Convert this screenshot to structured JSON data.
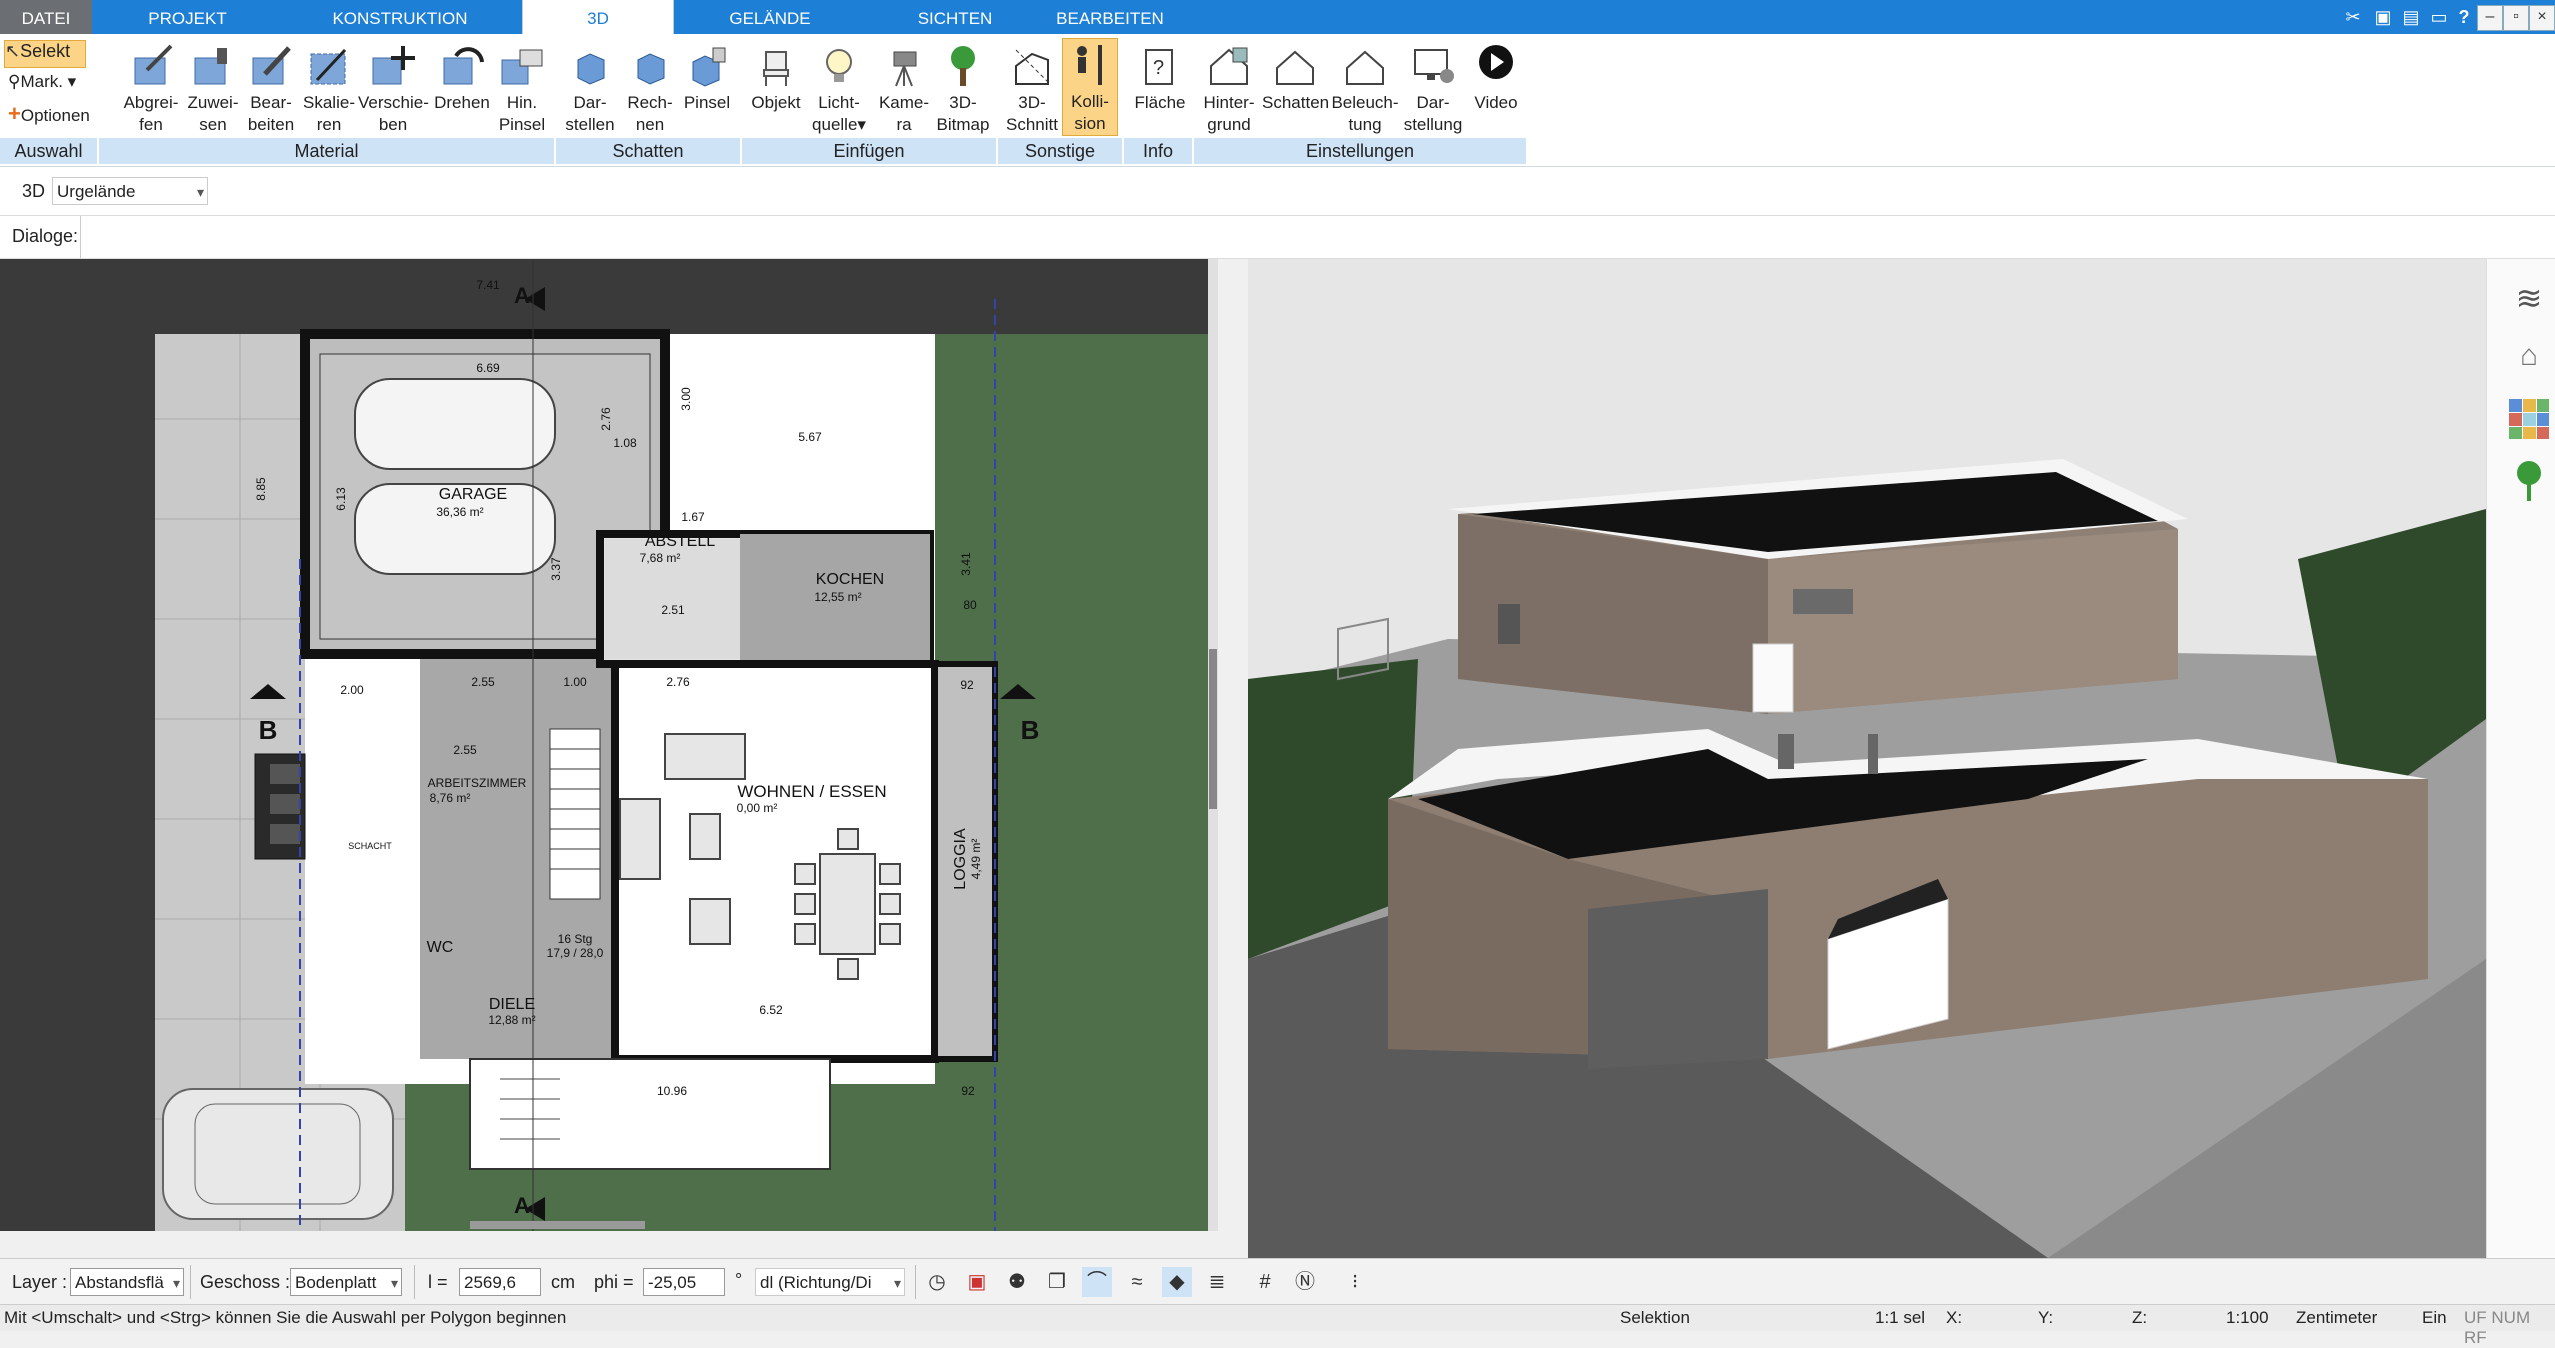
{
  "tabs": [
    {
      "label": "DATEI"
    },
    {
      "label": "PROJEKT"
    },
    {
      "label": "KONSTRUKTION"
    },
    {
      "label": "3D"
    },
    {
      "label": "GELÄNDE"
    },
    {
      "label": "SICHTEN"
    },
    {
      "label": "BEARBEITEN"
    }
  ],
  "auswahl": {
    "selekt": "Selekt",
    "mark": "Mark.",
    "optionen": "Optionen",
    "group": "Auswahl"
  },
  "ribbon_groups": {
    "material": {
      "label": "Material",
      "buttons": [
        {
          "l1": "Abgrei-",
          "l2": "fen"
        },
        {
          "l1": "Zuwei-",
          "l2": "sen"
        },
        {
          "l1": "Bear-",
          "l2": "beiten"
        },
        {
          "l1": "Skalie-",
          "l2": "ren"
        },
        {
          "l1": "Verschie-",
          "l2": "ben"
        },
        {
          "l1": "Drehen",
          "l2": ""
        },
        {
          "l1": "Hin.",
          "l2": "Pinsel"
        }
      ]
    },
    "schatten": {
      "label": "Schatten",
      "buttons": [
        {
          "l1": "Dar-",
          "l2": "stellen"
        },
        {
          "l1": "Rech-",
          "l2": "nen"
        },
        {
          "l1": "Pinsel",
          "l2": ""
        }
      ]
    },
    "einfuegen": {
      "label": "Einfügen",
      "buttons": [
        {
          "l1": "Objekt",
          "l2": ""
        },
        {
          "l1": "Licht-",
          "l2": "quelle"
        },
        {
          "l1": "Kame-",
          "l2": "ra"
        },
        {
          "l1": "3D-",
          "l2": "Bitmap"
        }
      ]
    },
    "sonstige": {
      "label": "Sonstige",
      "buttons": [
        {
          "l1": "3D-",
          "l2": "Schnitt"
        },
        {
          "l1": "Kolli-",
          "l2": "sion"
        }
      ]
    },
    "info": {
      "label": "Info",
      "buttons": [
        {
          "l1": "Fläche",
          "l2": ""
        }
      ]
    },
    "einstellungen": {
      "label": "Einstellungen",
      "buttons": [
        {
          "l1": "Hinter-",
          "l2": "grund"
        },
        {
          "l1": "Schatten",
          "l2": ""
        },
        {
          "l1": "Beleuch-",
          "l2": "tung"
        },
        {
          "l1": "Dar-",
          "l2": "stellung"
        },
        {
          "l1": "Video",
          "l2": ""
        }
      ]
    }
  },
  "toolbar": {
    "mode_label": "3D",
    "terrain_select": "Urgelände",
    "dialoge_label": "Dialoge:"
  },
  "plan": {
    "rooms": [
      {
        "name": "GARAGE",
        "area": "36,36 m²"
      },
      {
        "name": "ABSTELL",
        "area": "7,68 m²"
      },
      {
        "name": "KOCHEN",
        "area": "12,55 m²"
      },
      {
        "name": "ARBEITSZIMMER",
        "area": "8,76 m²"
      },
      {
        "name": "WOHNEN / ESSEN",
        "area": "0,00 m²"
      },
      {
        "name": "WC",
        "area": ""
      },
      {
        "name": "DIELE",
        "area": "12,88 m²"
      },
      {
        "name": "LOGGIA",
        "area": "4,49 m²"
      }
    ],
    "dims": [
      "7.41",
      "6.69",
      "5.67",
      "8.85",
      "6.13",
      "2.76",
      "1.08",
      "3.00",
      "1.67",
      "3.37",
      "2.51",
      "3.41",
      "80",
      "2.55",
      "1.00",
      "2.76",
      "92",
      "2.00",
      "2.55",
      "6.52",
      "10.96",
      "92",
      "16 Stg",
      "17,9 / 28,0",
      "SCHACHT"
    ],
    "section_label": "B",
    "section_arrow": "A"
  },
  "bottom": {
    "layer_label": "Layer :",
    "layer_value": "Abstandsflä",
    "geschoss_label": "Geschoss :",
    "geschoss_value": "Bodenplatt",
    "l_label": "l =",
    "l_value": "2569,6",
    "l_unit": "cm",
    "phi_label": "phi =",
    "phi_value": "-25,05",
    "phi_unit": "°",
    "dir_value": "dl (Richtung/Di"
  },
  "status": {
    "hint": "Mit <Umschalt> und <Strg> können Sie die Auswahl per Polygon beginnen",
    "mode": "Selektion",
    "sel": "1:1 sel",
    "x": "X:",
    "y": "Y:",
    "z": "Z:",
    "scale": "1:100",
    "unit": "Zentimeter",
    "ein": "Ein",
    "flags": "UF NUM RF"
  },
  "colors": {
    "tab_blue": "#1e7fd6",
    "group_bar": "#cfe3f7",
    "active_btn": "#fbd487",
    "grass": "#4f6e4a"
  }
}
